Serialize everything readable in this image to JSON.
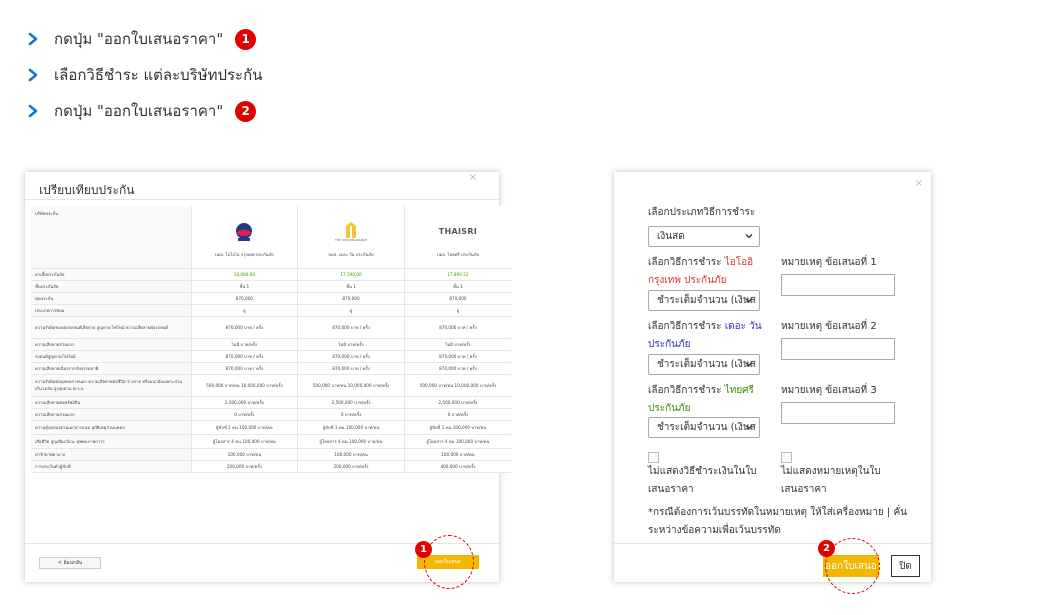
{
  "steps": [
    {
      "text": "กดปุ่ม \"ออกใบเสนอราคา\"",
      "num": "1"
    },
    {
      "text": "เลือกวิธีชำระ แต่ละบริษัทประกัน",
      "num": ""
    },
    {
      "text": "กดปุ่ม \"ออกใบเสนอราคา\"",
      "num": "2"
    }
  ],
  "compare": {
    "title": "เปรียบเทียบประกัน",
    "close": "×",
    "company_header": "บริษัทประกัน",
    "companies": [
      {
        "name": "บมจ. ไอโอไอ กรุงเทพ ประกันภัย",
        "logo_text": ""
      },
      {
        "name": "บมจ. เดอะ วัน ประกันภัย",
        "logo_text": "THE ONE INSURANCE"
      },
      {
        "name": "บมจ. ไทยศรี ประกันภัย",
        "logo_text": "THAISRI"
      }
    ],
    "rows": [
      {
        "label": "ค่าเบี้ยประกันภัย",
        "values": [
          "18,000.00",
          "17,590.00",
          "17,890.52"
        ],
        "green": true
      },
      {
        "label": "ชั้นประกันภัย",
        "values": [
          "ชั้น 1",
          "ชั้น 1",
          "ชั้น 1"
        ]
      },
      {
        "label": "ทุนประกัน",
        "values": [
          "870,000",
          "870,000",
          "870,000"
        ]
      },
      {
        "label": "ประเภทการซ่อม",
        "values": [
          "อู่",
          "อู่",
          "อู่"
        ]
      },
      {
        "label": "ความรับผิดชอบต่อรถยนต์เสียหาย สูญหาย ไฟไหม้ ความเสียหายต่อรถยนต์",
        "values": [
          "870,000 บาท / ครั้ง",
          "870,000 บาท / ครั้ง",
          "870,000 บาท / ครั้ง"
        ]
      },
      {
        "label": "ความเสียหายส่วนแรก",
        "values": [
          "ไม่มี บาท/ครั้ง",
          "ไม่มี บาท/ครั้ง",
          "ไม่มี บาท/ครั้ง"
        ]
      },
      {
        "label": "รถยนต์สูญหาย/ไฟไหม้",
        "values": [
          "870,000 บาท / ครั้ง",
          "870,000 บาท / ครั้ง",
          "870,000 บาท / ครั้ง"
        ]
      },
      {
        "label": "ความเสียหายเนื่องจากภัยธรรมชาติ",
        "values": [
          "870,000 บาท / ครั้ง",
          "870,000 บาท / ครั้ง",
          "870,000 บาท / ครั้ง"
        ]
      },
      {
        "label": "ความรับผิดต่อบุคคลภายนอก ความเสียหายต่อชีวิต ร่างกาย หรืออนามัยเฉพาะส่วนเกินวงเงิน สูงสุดตาม พ.ร.บ.",
        "values": [
          "500,000 บาท/คน 10,000,000 บาท/ครั้ง",
          "500,000 บาท/คน 10,000,000 บาท/ครั้ง",
          "500,000 บาท/คน 10,000,000 บาท/ครั้ง"
        ]
      },
      {
        "label": "ความเสียหายต่อทรัพย์สิน",
        "values": [
          "2,500,000 บาท/ครั้ง",
          "2,500,000 บาท/ครั้ง",
          "2,500,000 บาท/ครั้ง"
        ]
      },
      {
        "label": "ความเสียหายส่วนแรก",
        "values": [
          "0 บาท/ครั้ง",
          "0 บาท/ครั้ง",
          "0 บาท/ครั้ง"
        ]
      },
      {
        "label": "ความคุ้มครองตามเอกสารแนบ อุบัติเหตุส่วนบุคคล",
        "values": [
          "ผู้ขับขี่ 1 คน 100,000 บาท/คน",
          "ผู้ขับขี่ 1 คน 100,000 บาท/คน",
          "ผู้ขับขี่ 1 คน 100,000 บาท/คน"
        ]
      },
      {
        "label": "เสียชีวิต สูญเสียอวัยวะ ทุพพลภาพถาวร",
        "values": [
          "ผู้โดยสาร 4 คน 100,000 บาท/คน",
          "ผู้โดยสาร 4 คน 100,000 บาท/คน",
          "ผู้โดยสาร 4 คน 100,000 บาท/คน"
        ]
      },
      {
        "label": "ค่ารักษาพยาบาล",
        "values": [
          "100,000 บาท/คน",
          "100,000 บาท/คน",
          "100,000 บาท/คน"
        ]
      },
      {
        "label": "การประกันตัวผู้ขับขี่",
        "values": [
          "200,000 บาท/ครั้ง",
          "200,000 บาท/ครั้ง",
          "400,000 บาท/ครั้ง"
        ]
      }
    ],
    "back_label": "< ย้อนกลับ",
    "quote_label": "ออกใบเสนอ"
  },
  "payment": {
    "close": "×",
    "method_type_label": "เลือกประเภทวิธีการชำระ",
    "method_type_value": "เงินสด",
    "sections": [
      {
        "label_prefix": "เลือกวิธีการชำระ ",
        "company": "ไอโออิ กรุงเทพ ประกันภัย",
        "select_value": "ชำระเต็มจำนวน (เงินส",
        "note_label": "หมายเหตุ ข้อเสนอที่ 1"
      },
      {
        "label_prefix": "เลือกวิธีการชำระ ",
        "company": "เดอะ วัน ประกันภัย",
        "select_value": "ชำระเต็มจำนวน (เงินส",
        "note_label": "หมายเหตุ ข้อเสนอที่ 2"
      },
      {
        "label_prefix": "เลือกวิธีการชำระ ",
        "company": "ไทยศรี ประกันภัย",
        "select_value": "ชำระเต็มจำนวน (เงินส",
        "note_label": "หมายเหตุ ข้อเสนอที่ 3"
      }
    ],
    "hide_payment_label": "ไม่แสดงวิธีชำระเงินในใบเสนอราคา",
    "hide_note_label": "ไม่แสดงหมายเหตุในใบเสนอราคา",
    "warning": "*กรณีต้องการเว้นบรรทัดในหมายเหตุ ให้ใส่เครื่องหมาย | คั่นระหว่างข้อความเพื่อเว้นบรรทัด",
    "quote_label": "ออกใบเสนอ",
    "close_label": "ปิด"
  },
  "callouts": [
    "1",
    "2"
  ],
  "colors": {
    "accent_red": "#e00000",
    "button_yellow": "#f2b705",
    "chevron_blue": "#1a73c9",
    "green_value": "#3aa000"
  }
}
